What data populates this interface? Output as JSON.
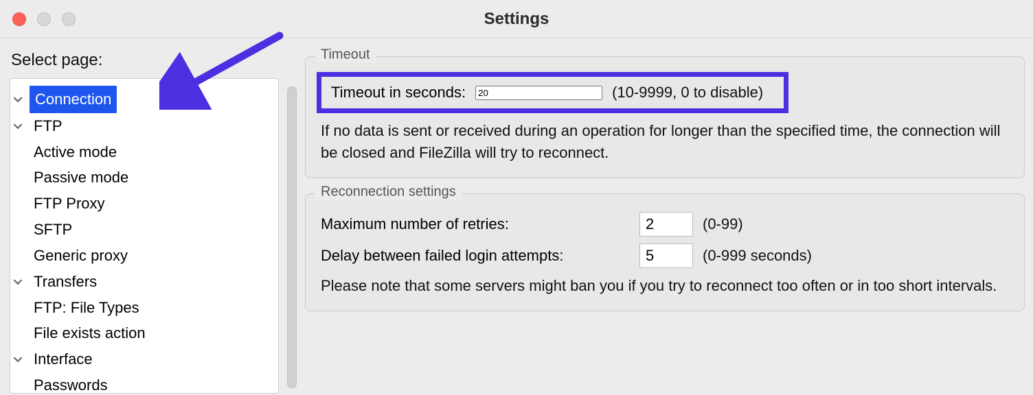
{
  "window": {
    "title": "Settings"
  },
  "sidebar": {
    "select_label": "Select page:",
    "items": {
      "connection": "Connection",
      "ftp": "FTP",
      "active_mode": "Active mode",
      "passive_mode": "Passive mode",
      "ftp_proxy": "FTP Proxy",
      "sftp": "SFTP",
      "generic_proxy": "Generic proxy",
      "transfers": "Transfers",
      "file_types": "FTP: File Types",
      "file_exists": "File exists action",
      "interface": "Interface",
      "passwords": "Passwords"
    }
  },
  "timeout": {
    "group_title": "Timeout",
    "label": "Timeout in seconds:",
    "value": "20",
    "range_hint": "(10-9999, 0 to disable)",
    "description": "If no data is sent or received during an operation for longer than the specified time, the connection will be closed and FileZilla will try to reconnect."
  },
  "reconnect": {
    "group_title": "Reconnection settings",
    "retries_label": "Maximum number of retries:",
    "retries_value": "2",
    "retries_hint": "(0-99)",
    "delay_label": "Delay between failed login attempts:",
    "delay_value": "5",
    "delay_hint": "(0-999 seconds)",
    "description": "Please note that some servers might ban you if you try to reconnect too often or in too short intervals."
  },
  "annotation": {
    "arrow_color": "#4b2fe0"
  }
}
